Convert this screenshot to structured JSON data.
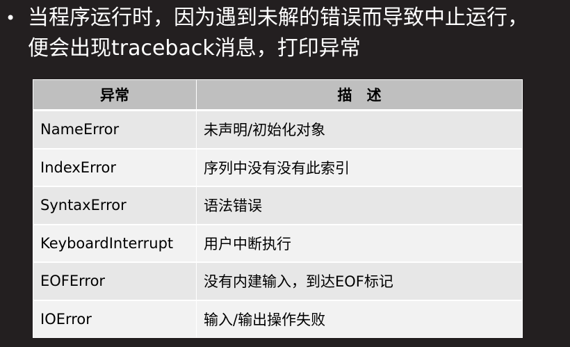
{
  "slide": {
    "bullet": {
      "line1": "当程序运行时，因为遇到未解的错误而导致中止运行，",
      "line2": "便会出现traceback消息，打印异常"
    },
    "table": {
      "headers": [
        "异常",
        "描　述"
      ],
      "rows": [
        {
          "name": "NameError",
          "desc": "未声明/初始化对象"
        },
        {
          "name": "IndexError",
          "desc": "序列中没有没有此索引"
        },
        {
          "name": "SyntaxError",
          "desc": "语法错误"
        },
        {
          "name": "KeyboardInterrupt",
          "desc": "用户中断执行"
        },
        {
          "name": "EOFError",
          "desc": "没有内建输入，到达EOF标记"
        },
        {
          "name": "IOError",
          "desc": "输入/输出操作失败"
        }
      ]
    }
  },
  "colors": {
    "background": "#231f20",
    "header_fill": "#bfbfbf",
    "row_fill": "#e7e7e7",
    "row_fill_alt": "#f2f2f2"
  }
}
